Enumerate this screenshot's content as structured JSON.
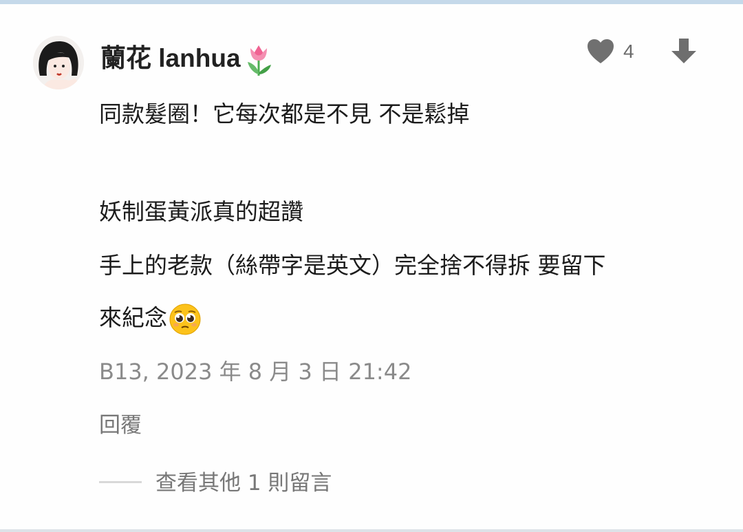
{
  "comment": {
    "author": "蘭花 lanhua",
    "author_badge_icon": "tulip-emoji",
    "like_icon": "heart-icon",
    "like_count": "4",
    "dislike_icon": "arrow-down-icon",
    "body_lines": [
      "同款髮圈！它每次都是不見 不是鬆掉",
      "妖制蛋黃派真的超讚",
      "手上的老款（絲帶字是英文）完全捨不得拆 要留下",
      "來紀念"
    ],
    "body_end_emoji": "pleading-face-emoji",
    "timestamp": "B13, 2023 年 8 月 3 日 21:42",
    "reply_label": "回覆",
    "view_more_label": "查看其他 1 則留言"
  },
  "colors": {
    "text": "#1c1c1c",
    "muted": "#8a8a8a",
    "icon": "#6e6e6e",
    "accent_border": "#c5d9ea"
  }
}
